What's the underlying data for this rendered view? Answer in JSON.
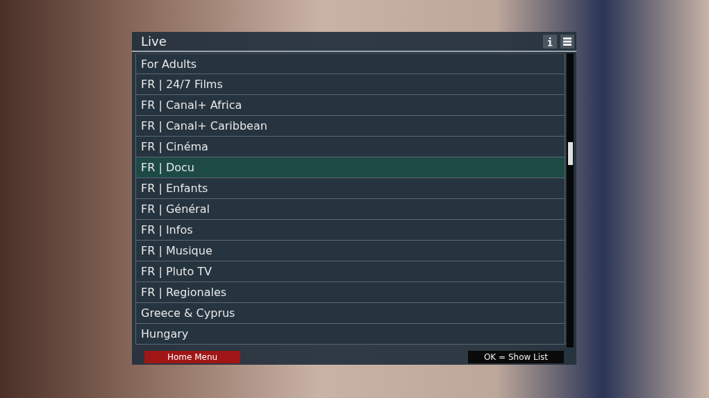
{
  "window": {
    "title": "Live"
  },
  "items": [
    {
      "label": "For Adults",
      "selected": false
    },
    {
      "label": "FR | 24/7 Films",
      "selected": false
    },
    {
      "label": "FR | Canal+ Africa",
      "selected": false
    },
    {
      "label": "FR | Canal+ Caribbean",
      "selected": false
    },
    {
      "label": "FR | Cinéma",
      "selected": false
    },
    {
      "label": "FR | Docu",
      "selected": true
    },
    {
      "label": "FR | Enfants",
      "selected": false
    },
    {
      "label": "FR | Général",
      "selected": false
    },
    {
      "label": "FR | Infos",
      "selected": false
    },
    {
      "label": "FR | Musique",
      "selected": false
    },
    {
      "label": "FR | Pluto TV",
      "selected": false
    },
    {
      "label": "FR | Regionales",
      "selected": false
    },
    {
      "label": "Greece & Cyprus",
      "selected": false
    },
    {
      "label": "Hungary",
      "selected": false
    }
  ],
  "footer": {
    "red_button": "Home Menu",
    "hint": "OK = Show List"
  }
}
